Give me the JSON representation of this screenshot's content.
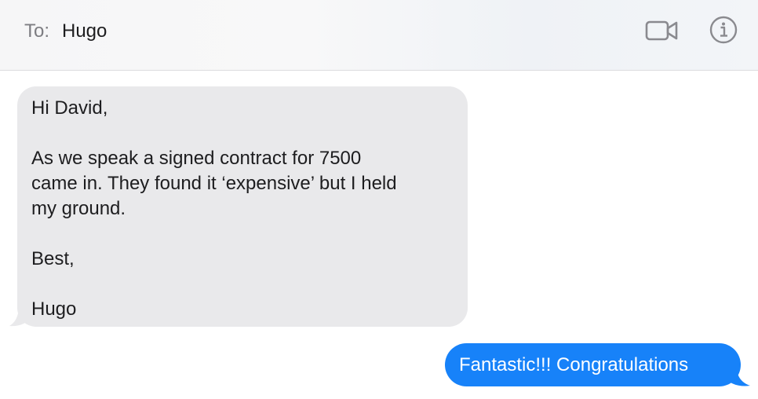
{
  "header": {
    "to_label": "To:",
    "recipient": "Hugo",
    "video_icon": "video-camera-icon",
    "info_icon": "info-icon"
  },
  "messages": [
    {
      "direction": "incoming",
      "text": "Hi David,\n\nAs we speak a signed contract for 7500\ncame in. They found it ‘expensive’ but I held\nmy ground.\n\nBest,\n\nHugo"
    },
    {
      "direction": "outgoing",
      "text": "Fantastic!!! Congratulations"
    }
  ],
  "colors": {
    "incoming_bubble": "#e9e9eb",
    "outgoing_bubble": "#1782f9",
    "header_text_muted": "#7d7d82"
  }
}
